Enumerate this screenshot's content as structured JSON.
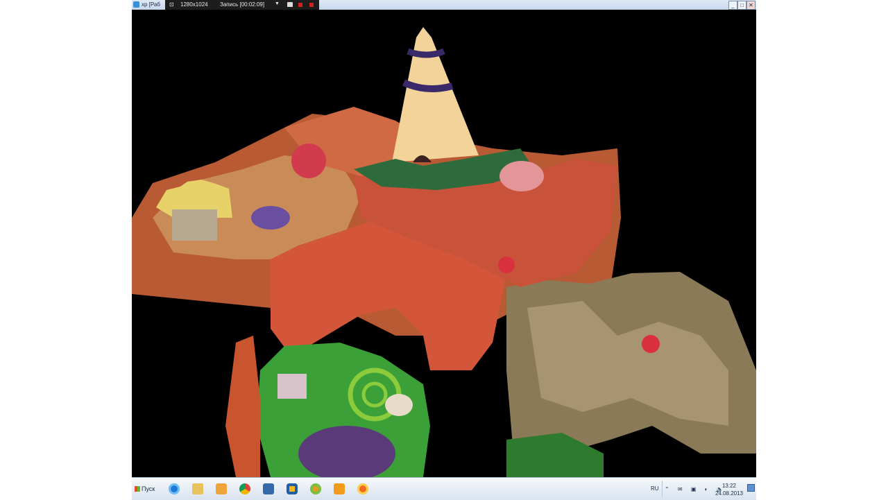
{
  "window": {
    "title": "xp [Раб",
    "recorder": {
      "resolution": "1280x1024",
      "recording": "Запись [00:02:09]",
      "dropdown_glyph": "▼"
    },
    "controls": {
      "minimize": "_",
      "maximize": "□",
      "close": "✕"
    }
  },
  "colors": {
    "background": "#000000",
    "rock_orange": "#d4603e",
    "rock_tan": "#9c8864",
    "grass_green": "#3ca038",
    "tower_cream": "#f2d49a"
  },
  "taskbar": {
    "start_label": "Пуск",
    "pinned": [
      {
        "name": "internet-explorer-icon"
      },
      {
        "name": "folder-icon"
      },
      {
        "name": "media-player-icon"
      },
      {
        "name": "chrome-icon"
      },
      {
        "name": "virtualbox-icon"
      },
      {
        "name": "mail-icon"
      },
      {
        "name": "game-center-icon"
      },
      {
        "name": "odnoklassniki-icon"
      },
      {
        "name": "app-icon"
      }
    ],
    "language": "RU",
    "tray_icons": "⌃ ✉ ▣ ◐ 🔈",
    "time": "13:22",
    "date": "24.08.2013"
  }
}
